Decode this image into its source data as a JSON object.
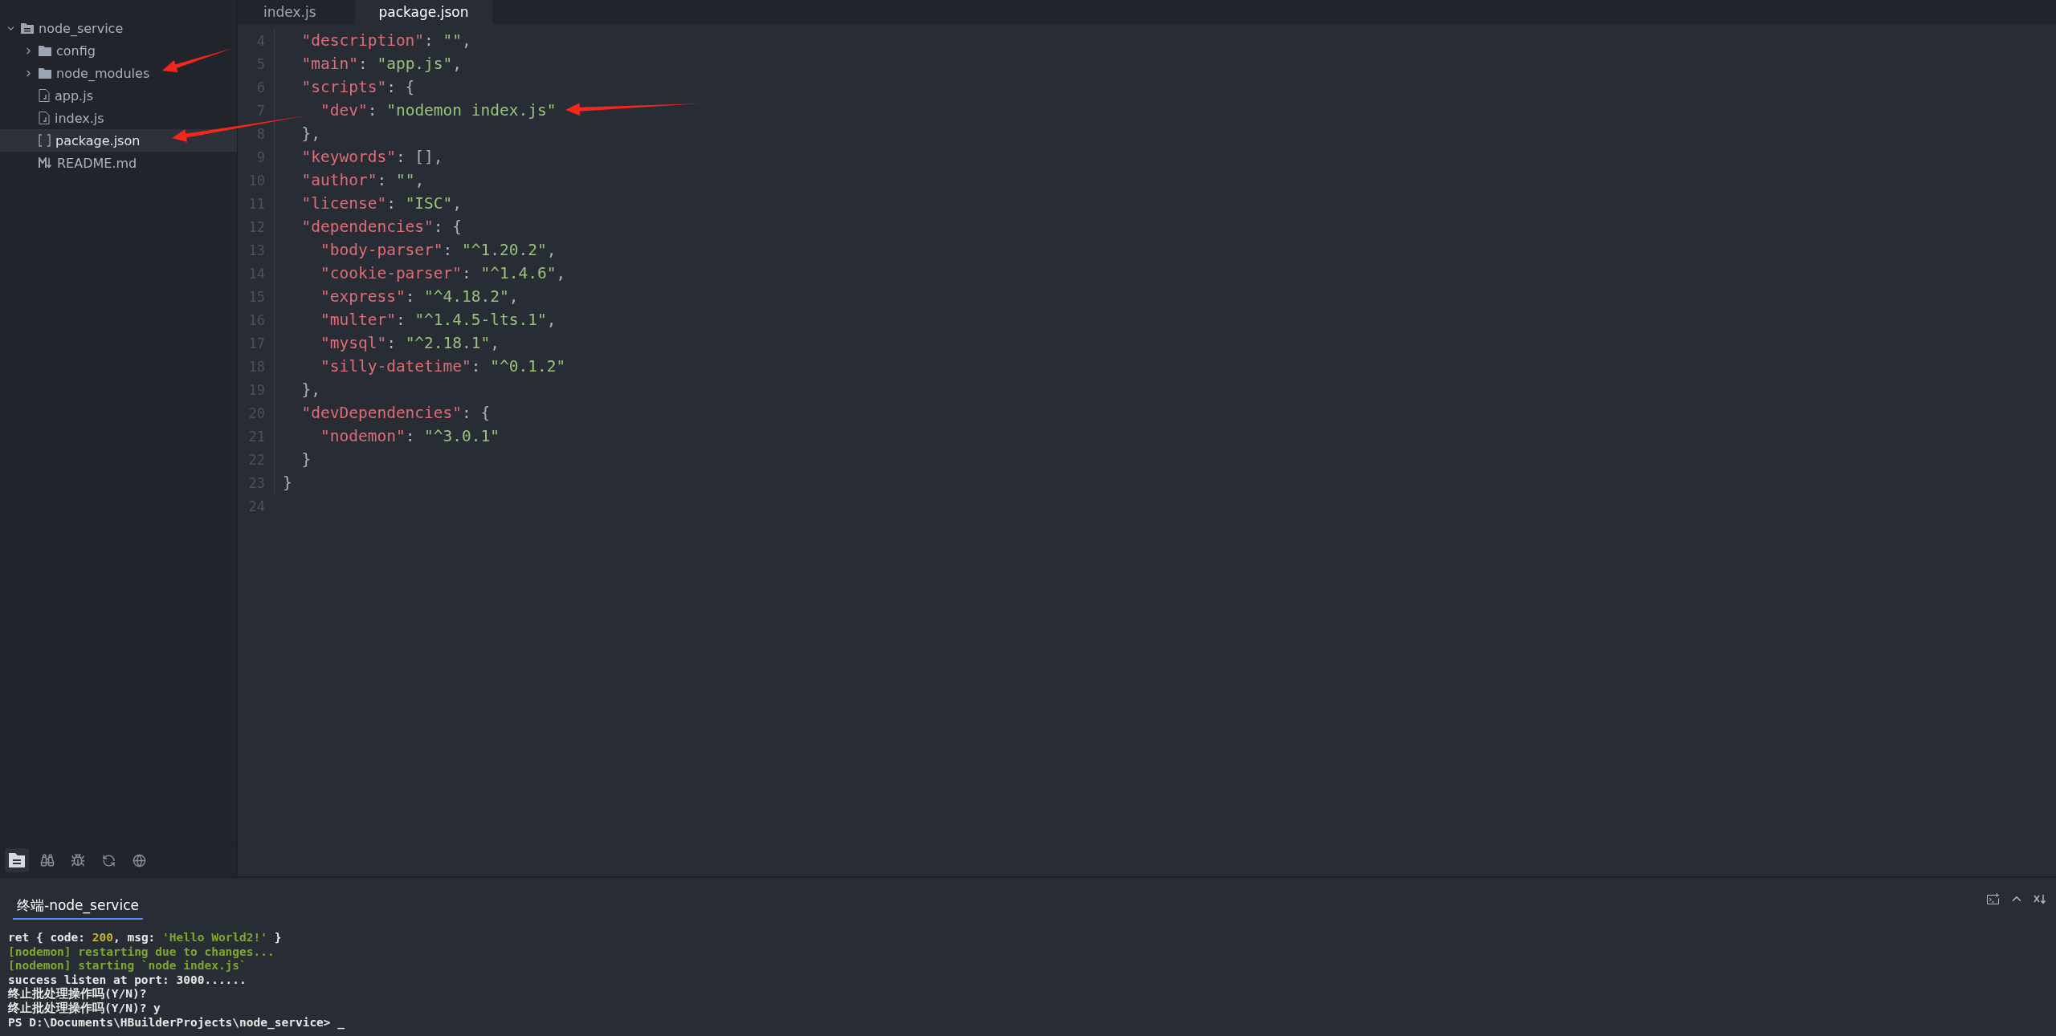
{
  "sidebar": {
    "tree": [
      {
        "name": "node_service",
        "kind": "project",
        "expanded": true,
        "selected": false,
        "children": [
          {
            "name": "config",
            "kind": "folder",
            "expanded": false,
            "selected": false
          },
          {
            "name": "node_modules",
            "kind": "folder",
            "expanded": false,
            "selected": false
          },
          {
            "name": "app.js",
            "kind": "js",
            "selected": false
          },
          {
            "name": "index.js",
            "kind": "js",
            "selected": false
          },
          {
            "name": "package.json",
            "kind": "json",
            "selected": true
          },
          {
            "name": "README.md",
            "kind": "markdown",
            "selected": false
          }
        ]
      }
    ],
    "panel_tabs": [
      {
        "kind": "files",
        "selected": true
      },
      {
        "kind": "search",
        "selected": false
      },
      {
        "kind": "debug",
        "selected": false
      },
      {
        "kind": "git",
        "selected": false
      },
      {
        "kind": "web",
        "selected": false
      }
    ]
  },
  "editor": {
    "tabs": [
      {
        "label": "index.js",
        "selected": false
      },
      {
        "label": "package.json",
        "selected": true
      }
    ],
    "lines": [
      {
        "number": "4",
        "tokens": [
          {
            "kind": "key",
            "text": "  \"description\""
          },
          {
            "kind": "punct",
            "text": ": "
          },
          {
            "kind": "string",
            "text": "\"\""
          },
          {
            "kind": "punct",
            "text": ","
          }
        ]
      },
      {
        "number": "5",
        "tokens": [
          {
            "kind": "key",
            "text": "  \"main\""
          },
          {
            "kind": "punct",
            "text": ": "
          },
          {
            "kind": "string",
            "text": "\"app.js\""
          },
          {
            "kind": "punct",
            "text": ","
          }
        ]
      },
      {
        "number": "6",
        "tokens": [
          {
            "kind": "key",
            "text": "  \"scripts\""
          },
          {
            "kind": "punct",
            "text": ": {"
          }
        ]
      },
      {
        "number": "7",
        "tokens": [
          {
            "kind": "key",
            "text": "    \"dev\""
          },
          {
            "kind": "punct",
            "text": ": "
          },
          {
            "kind": "string",
            "text": "\"nodemon index.js\""
          }
        ]
      },
      {
        "number": "8",
        "tokens": [
          {
            "kind": "punct",
            "text": "  },"
          }
        ]
      },
      {
        "number": "9",
        "tokens": [
          {
            "kind": "key",
            "text": "  \"keywords\""
          },
          {
            "kind": "punct",
            "text": ": [],"
          }
        ]
      },
      {
        "number": "10",
        "tokens": [
          {
            "kind": "key",
            "text": "  \"author\""
          },
          {
            "kind": "punct",
            "text": ": "
          },
          {
            "kind": "string",
            "text": "\"\""
          },
          {
            "kind": "punct",
            "text": ","
          }
        ]
      },
      {
        "number": "11",
        "tokens": [
          {
            "kind": "key",
            "text": "  \"license\""
          },
          {
            "kind": "punct",
            "text": ": "
          },
          {
            "kind": "string",
            "text": "\"ISC\""
          },
          {
            "kind": "punct",
            "text": ","
          }
        ]
      },
      {
        "number": "12",
        "tokens": [
          {
            "kind": "key",
            "text": "  \"dependencies\""
          },
          {
            "kind": "punct",
            "text": ": {"
          }
        ]
      },
      {
        "number": "13",
        "tokens": [
          {
            "kind": "key",
            "text": "    \"body-parser\""
          },
          {
            "kind": "punct",
            "text": ": "
          },
          {
            "kind": "string",
            "text": "\"^1.20.2\""
          },
          {
            "kind": "punct",
            "text": ","
          }
        ]
      },
      {
        "number": "14",
        "tokens": [
          {
            "kind": "key",
            "text": "    \"cookie-parser\""
          },
          {
            "kind": "punct",
            "text": ": "
          },
          {
            "kind": "string",
            "text": "\"^1.4.6\""
          },
          {
            "kind": "punct",
            "text": ","
          }
        ]
      },
      {
        "number": "15",
        "tokens": [
          {
            "kind": "key",
            "text": "    \"express\""
          },
          {
            "kind": "punct",
            "text": ": "
          },
          {
            "kind": "string",
            "text": "\"^4.18.2\""
          },
          {
            "kind": "punct",
            "text": ","
          }
        ]
      },
      {
        "number": "16",
        "tokens": [
          {
            "kind": "key",
            "text": "    \"multer\""
          },
          {
            "kind": "punct",
            "text": ": "
          },
          {
            "kind": "string",
            "text": "\"^1.4.5-lts.1\""
          },
          {
            "kind": "punct",
            "text": ","
          }
        ]
      },
      {
        "number": "17",
        "tokens": [
          {
            "kind": "key",
            "text": "    \"mysql\""
          },
          {
            "kind": "punct",
            "text": ": "
          },
          {
            "kind": "string",
            "text": "\"^2.18.1\""
          },
          {
            "kind": "punct",
            "text": ","
          }
        ]
      },
      {
        "number": "18",
        "tokens": [
          {
            "kind": "key",
            "text": "    \"silly-datetime\""
          },
          {
            "kind": "punct",
            "text": ": "
          },
          {
            "kind": "string",
            "text": "\"^0.1.2\""
          }
        ]
      },
      {
        "number": "19",
        "tokens": [
          {
            "kind": "punct",
            "text": "  },"
          }
        ]
      },
      {
        "number": "20",
        "tokens": [
          {
            "kind": "key",
            "text": "  \"devDependencies\""
          },
          {
            "kind": "punct",
            "text": ": {"
          }
        ]
      },
      {
        "number": "21",
        "tokens": [
          {
            "kind": "key",
            "text": "    \"nodemon\""
          },
          {
            "kind": "punct",
            "text": ": "
          },
          {
            "kind": "string",
            "text": "\"^3.0.1\""
          }
        ]
      },
      {
        "number": "22",
        "tokens": [
          {
            "kind": "punct",
            "text": "  }"
          }
        ]
      },
      {
        "number": "23",
        "tokens": [
          {
            "kind": "punct",
            "text": "}"
          }
        ]
      },
      {
        "number": "24"
      }
    ]
  },
  "terminal": {
    "tab": {
      "label": "终端-node_service",
      "selected": true
    },
    "lines": [
      [
        {
          "kind": "plain",
          "text": "ret { code: "
        },
        {
          "kind": "number",
          "text": "200"
        },
        {
          "kind": "plain",
          "text": ", msg: "
        },
        {
          "kind": "string",
          "text": "'Hello World2!'"
        },
        {
          "kind": "plain",
          "text": " }"
        }
      ],
      [
        {
          "kind": "info",
          "text": "[nodemon] restarting due to changes..."
        }
      ],
      [
        {
          "kind": "info",
          "text": "[nodemon] starting `node index.js`"
        }
      ],
      [
        {
          "kind": "plain",
          "text": "success listen at port: 3000......"
        }
      ],
      [
        {
          "kind": "plain",
          "text": "终止批处理操作吗(Y/N)?"
        }
      ],
      [
        {
          "kind": "plain",
          "text": "终止批处理操作吗(Y/N)? y"
        }
      ],
      [
        {
          "kind": "plain",
          "text": "PS D:\\Documents\\HBuilderProjects\\node_service> _"
        }
      ]
    ]
  },
  "annotations": [
    {
      "kind": "arrow"
    },
    {
      "kind": "arrow"
    },
    {
      "kind": "arrow"
    }
  ]
}
